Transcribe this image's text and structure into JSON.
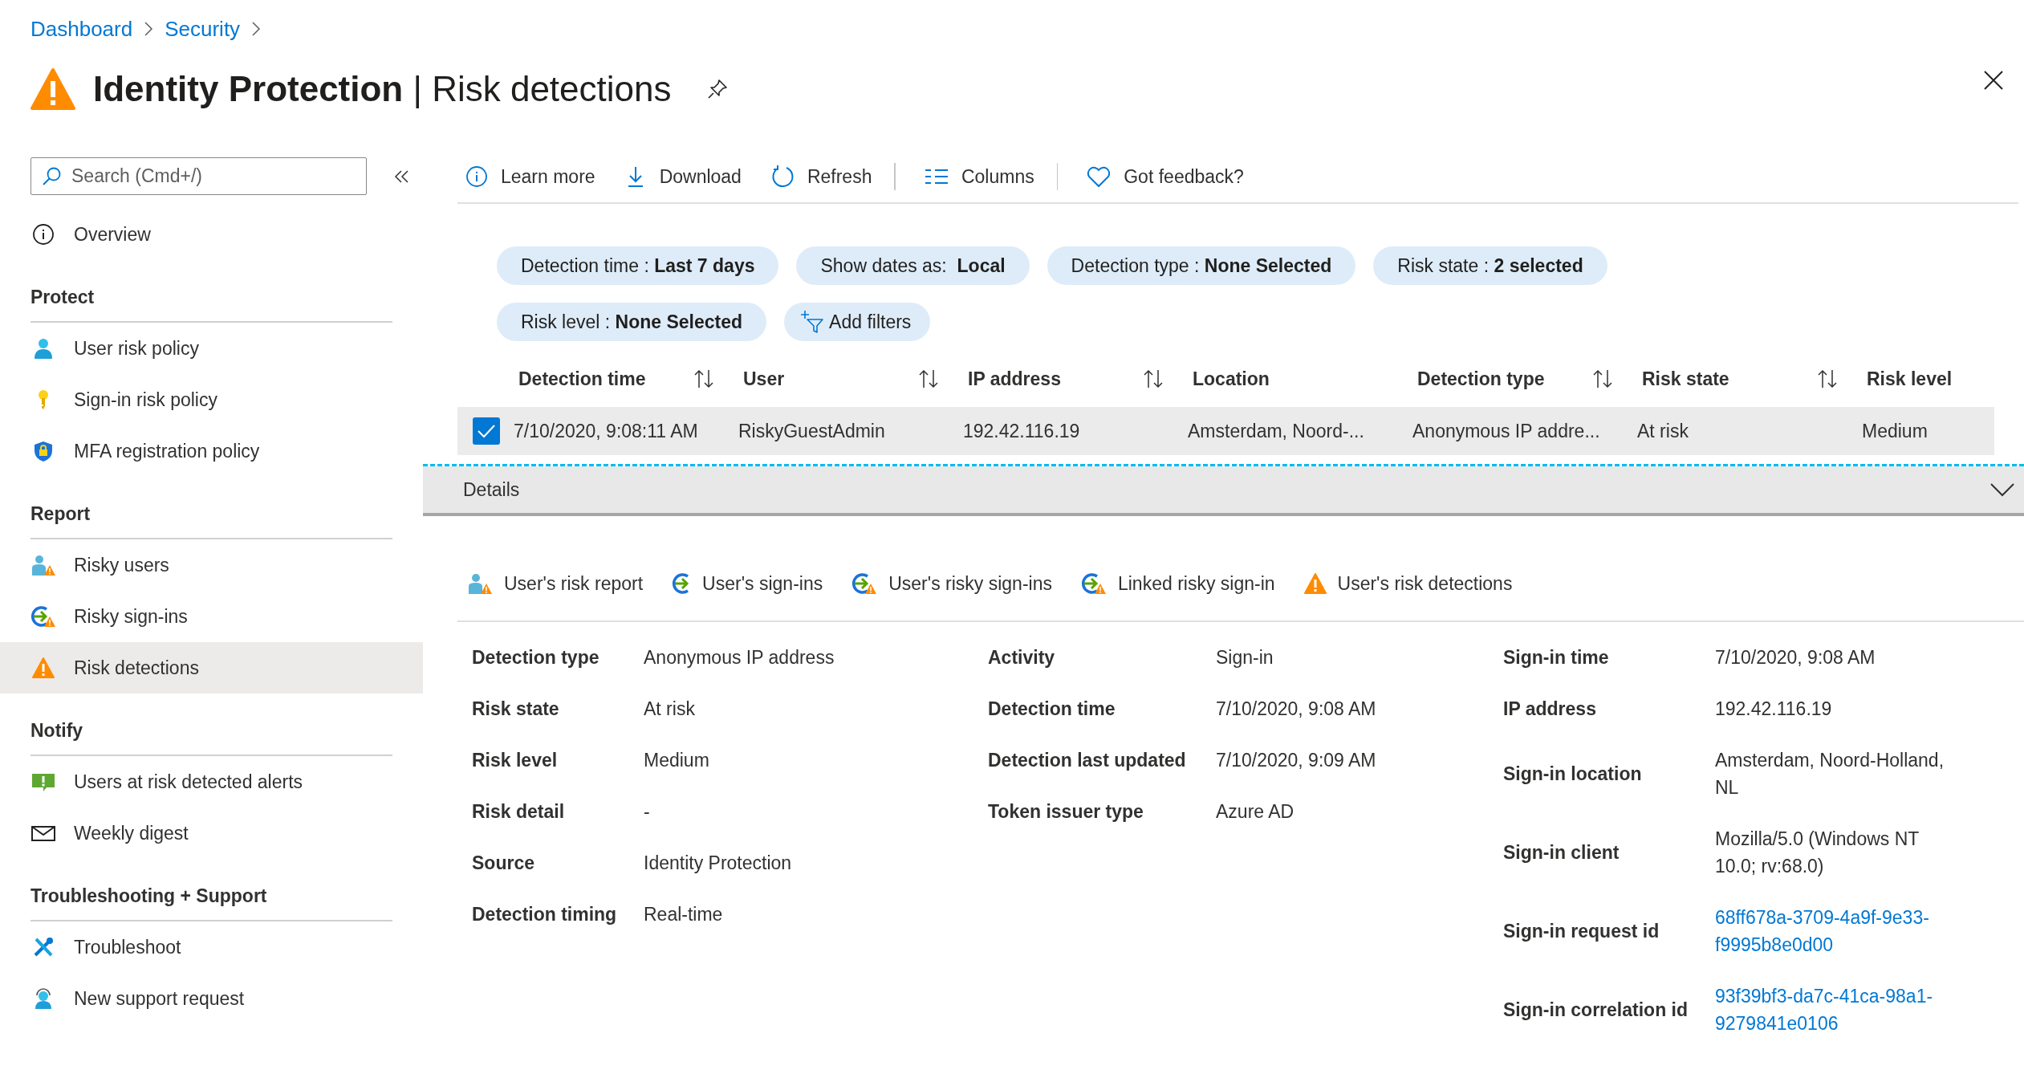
{
  "breadcrumb": [
    {
      "label": "Dashboard"
    },
    {
      "label": "Security"
    }
  ],
  "title": "**Identity Protection** | Risk detections",
  "sidebar": {
    "search": {
      "placeholder": "Search (Cmd+/)"
    },
    "overview": {
      "label": "Overview",
      "selected": false
    },
    "sections": [
      {
        "heading": "Protect",
        "items": [
          {
            "label": "User risk policy",
            "selected": false
          },
          {
            "label": "Sign-in risk policy",
            "selected": false
          },
          {
            "label": "MFA registration policy",
            "selected": false
          }
        ]
      },
      {
        "heading": "Report",
        "items": [
          {
            "label": "Risky users",
            "selected": false
          },
          {
            "label": "Risky sign-ins",
            "selected": false
          },
          {
            "label": "Risk detections",
            "selected": true
          }
        ]
      },
      {
        "heading": "Notify",
        "items": [
          {
            "label": "Users at risk detected alerts",
            "selected": false
          },
          {
            "label": "Weekly digest",
            "selected": false
          }
        ]
      },
      {
        "heading": "Troubleshooting + Support",
        "items": [
          {
            "label": "Troubleshoot",
            "selected": false
          },
          {
            "label": "New support request",
            "selected": false
          }
        ]
      }
    ]
  },
  "toolbar": [
    {
      "label": "Learn more"
    },
    {
      "label": "Download"
    },
    {
      "label": "Refresh"
    },
    {
      "label": "Columns"
    },
    {
      "label": "Got feedback?"
    }
  ],
  "filters": [
    {
      "text": "Detection time : **Last 7 days**"
    },
    {
      "text": "Show dates as:  **Local**"
    },
    {
      "text": "Detection type : **None Selected**"
    },
    {
      "text": "Risk state : **2 selected**"
    },
    {
      "text": "Risk level : **None Selected**"
    }
  ],
  "add_filters": "Add filters",
  "table": {
    "columns": [
      {
        "label": "Detection time",
        "sortable": true
      },
      {
        "label": "User",
        "sortable": true
      },
      {
        "label": "IP address",
        "sortable": true
      },
      {
        "label": "Location",
        "sortable": false
      },
      {
        "label": "Detection type",
        "sortable": true
      },
      {
        "label": "Risk state",
        "sortable": true
      },
      {
        "label": "Risk level",
        "sortable": false
      }
    ],
    "rows": [
      {
        "selected": true,
        "cells": [
          "7/10/2020, 9:08:11 AM",
          "RiskyGuestAdmin",
          "192.42.116.19",
          "Amsterdam, Noord-...",
          "Anonymous IP addre...",
          "At risk",
          "Medium"
        ]
      }
    ]
  },
  "details": {
    "title": "Details",
    "expanded": true,
    "links": [
      {
        "label": "User's risk report"
      },
      {
        "label": "User's sign-ins"
      },
      {
        "label": "User's risky sign-ins"
      },
      {
        "label": "Linked risky sign-in"
      },
      {
        "label": "User's risk detections"
      }
    ],
    "columns": [
      [
        {
          "label": "Detection type",
          "value": "Anonymous IP address",
          "kind": "text"
        },
        {
          "label": "Risk state",
          "value": "At risk",
          "kind": "text"
        },
        {
          "label": "Risk level",
          "value": "Medium",
          "kind": "text"
        },
        {
          "label": "Risk detail",
          "value": "-",
          "kind": "text"
        },
        {
          "label": "Source",
          "value": "Identity Protection",
          "kind": "text"
        },
        {
          "label": "Detection timing",
          "value": "Real-time",
          "kind": "text"
        }
      ],
      [
        {
          "label": "Activity",
          "value": "Sign-in",
          "kind": "text"
        },
        {
          "label": "Detection time",
          "value": "7/10/2020, 9:08 AM",
          "kind": "text"
        },
        {
          "label": "Detection last updated",
          "value": "7/10/2020, 9:09 AM",
          "kind": "text"
        },
        {
          "label": "Token issuer type",
          "value": "Azure AD",
          "kind": "text"
        }
      ],
      [
        {
          "label": "Sign-in time",
          "value": "7/10/2020, 9:08 AM",
          "kind": "text"
        },
        {
          "label": "IP address",
          "value": "192.42.116.19",
          "kind": "text"
        },
        {
          "label": "Sign-in location",
          "value": "Amsterdam, Noord-Holland, NL",
          "kind": "text"
        },
        {
          "label": "Sign-in client",
          "value": "Mozilla/5.0 (Windows NT 10.0; rv:68.0)",
          "kind": "text"
        },
        {
          "label": "Sign-in request id",
          "value": "68ff678a-3709-4a9f-9e33-f9995b8e0d00",
          "kind": "link"
        },
        {
          "label": "Sign-in correlation id",
          "value": "93f39bf3-da7c-41ca-98a1-9279841e0106",
          "kind": "link"
        }
      ]
    ]
  }
}
